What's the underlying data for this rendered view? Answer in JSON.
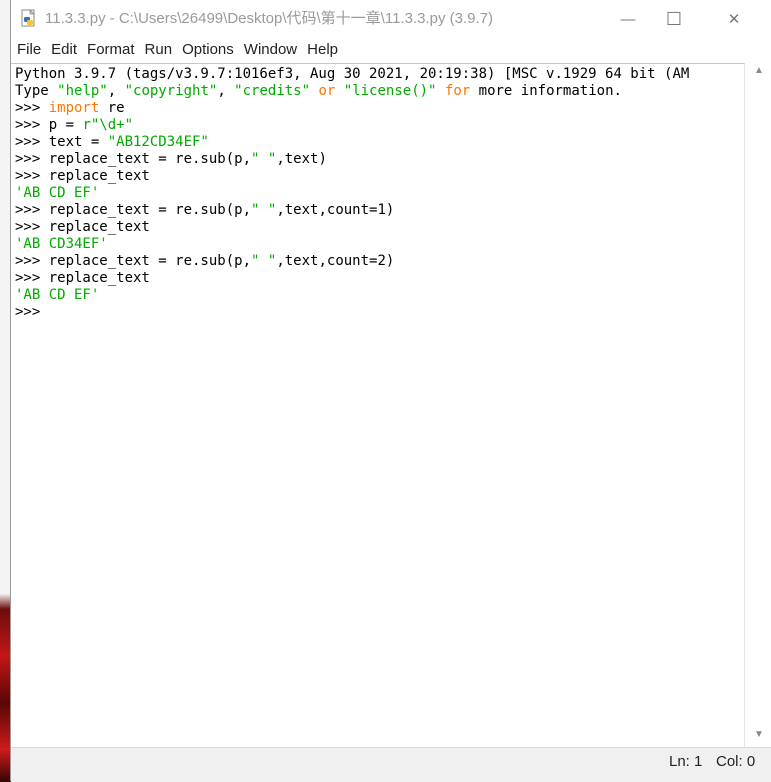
{
  "window": {
    "title": "11.3.3.py - C:\\Users\\26499\\Desktop\\代码\\第十一章\\11.3.3.py (3.9.7)",
    "buttons": {
      "minimize": "—",
      "maximize": "☐",
      "close": "✕"
    }
  },
  "menu": [
    "File",
    "Edit",
    "Format",
    "Run",
    "Options",
    "Window",
    "Help"
  ],
  "shell": {
    "lines": [
      [
        {
          "t": "Python 3.9.7 (tags/v3.9.7:1016ef3, Aug 30 2021, 20:19:38) [MSC v.1929 64 bit (AM",
          "c": "plain"
        }
      ],
      [
        {
          "t": "Type ",
          "c": "plain"
        },
        {
          "t": "\"help\"",
          "c": "str"
        },
        {
          "t": ", ",
          "c": "plain"
        },
        {
          "t": "\"copyright\"",
          "c": "str"
        },
        {
          "t": ", ",
          "c": "plain"
        },
        {
          "t": "\"credits\"",
          "c": "str"
        },
        {
          "t": " ",
          "c": "plain"
        },
        {
          "t": "or",
          "c": "kw"
        },
        {
          "t": " ",
          "c": "plain"
        },
        {
          "t": "\"license()\"",
          "c": "str"
        },
        {
          "t": " ",
          "c": "plain"
        },
        {
          "t": "for",
          "c": "kw"
        },
        {
          "t": " more information.",
          "c": "plain"
        }
      ],
      [
        {
          "t": ">>> ",
          "c": "plain"
        },
        {
          "t": "import",
          "c": "kw"
        },
        {
          "t": " re",
          "c": "plain"
        }
      ],
      [
        {
          "t": ">>> p = ",
          "c": "plain"
        },
        {
          "t": "r\"\\d+\"",
          "c": "str"
        }
      ],
      [
        {
          "t": ">>> text = ",
          "c": "plain"
        },
        {
          "t": "\"AB12CD34EF\"",
          "c": "str"
        }
      ],
      [
        {
          "t": ">>> replace_text = re.sub(p,",
          "c": "plain"
        },
        {
          "t": "\" \"",
          "c": "str"
        },
        {
          "t": ",text)",
          "c": "plain"
        }
      ],
      [
        {
          "t": ">>> replace_text",
          "c": "plain"
        }
      ],
      [
        {
          "t": "'AB CD EF'",
          "c": "str"
        }
      ],
      [
        {
          "t": ">>> replace_text = re.sub(p,",
          "c": "plain"
        },
        {
          "t": "\" \"",
          "c": "str"
        },
        {
          "t": ",text,count=1)",
          "c": "plain"
        }
      ],
      [
        {
          "t": ">>> replace_text",
          "c": "plain"
        }
      ],
      [
        {
          "t": "'AB CD34EF'",
          "c": "str"
        }
      ],
      [
        {
          "t": ">>> replace_text = re.sub(p,",
          "c": "plain"
        },
        {
          "t": "\" \"",
          "c": "str"
        },
        {
          "t": ",text,count=2)",
          "c": "plain"
        }
      ],
      [
        {
          "t": ">>> replace_text",
          "c": "plain"
        }
      ],
      [
        {
          "t": "'AB CD EF'",
          "c": "str"
        }
      ],
      [
        {
          "t": ">>> ",
          "c": "plain"
        }
      ]
    ]
  },
  "status": {
    "ln": "Ln: 1",
    "col": "Col: 0"
  },
  "colors": {
    "keyword": "#ff7700",
    "string": "#00aa00",
    "text": "#000000"
  }
}
